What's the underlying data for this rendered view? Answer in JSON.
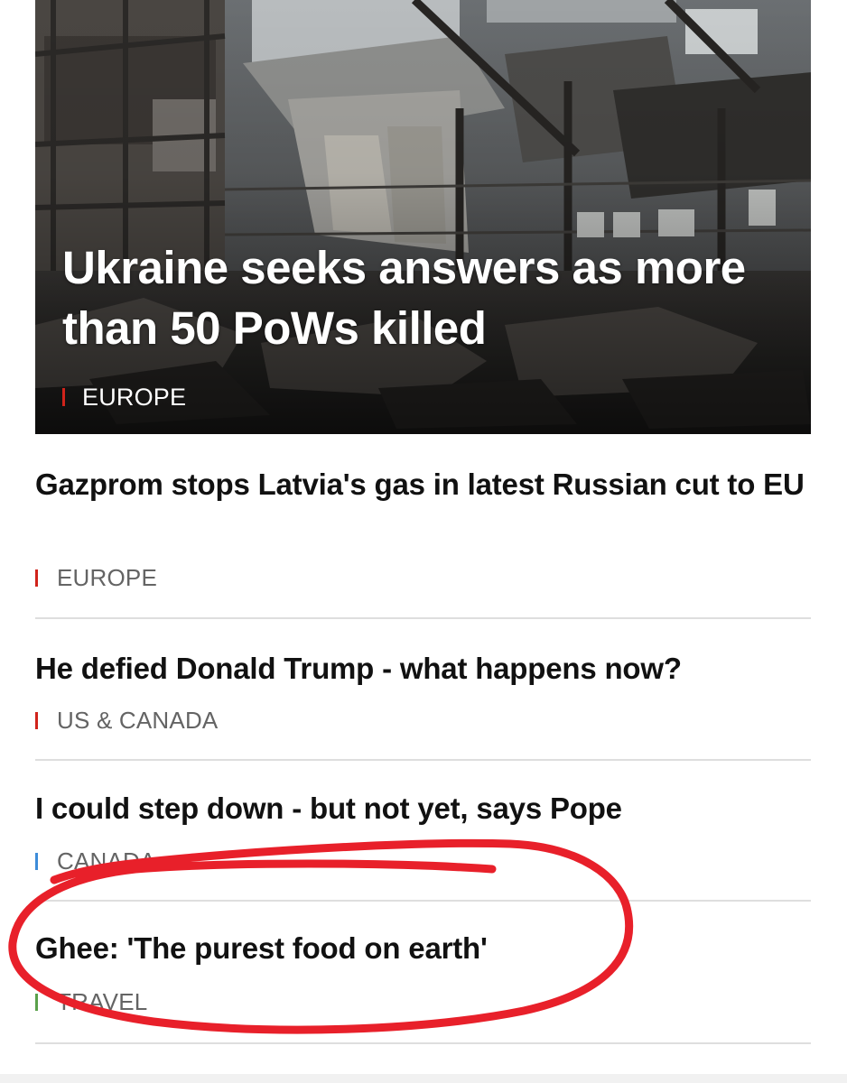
{
  "hero": {
    "headline": "Ukraine seeks answers as more than 50 PoWs killed",
    "tag": "EUROPE",
    "tag_color": "#d0231b"
  },
  "stories": [
    {
      "title": "Gazprom stops Latvia's gas in latest Russian cut to EU",
      "tag": "EUROPE",
      "tag_color": "#d0231b"
    },
    {
      "title": "He defied Donald Trump - what happens now?",
      "tag": "US & CANADA",
      "tag_color": "#d0231b"
    },
    {
      "title": "I could step down - but not yet, says Pope",
      "tag": "CANADA",
      "tag_color": "#3d8cd9"
    },
    {
      "title": "Ghee: 'The purest food on earth'",
      "tag": "TRAVEL",
      "tag_color": "#5aa14b"
    }
  ],
  "annotation": {
    "type": "hand-drawn circle",
    "color": "#e8202a"
  }
}
